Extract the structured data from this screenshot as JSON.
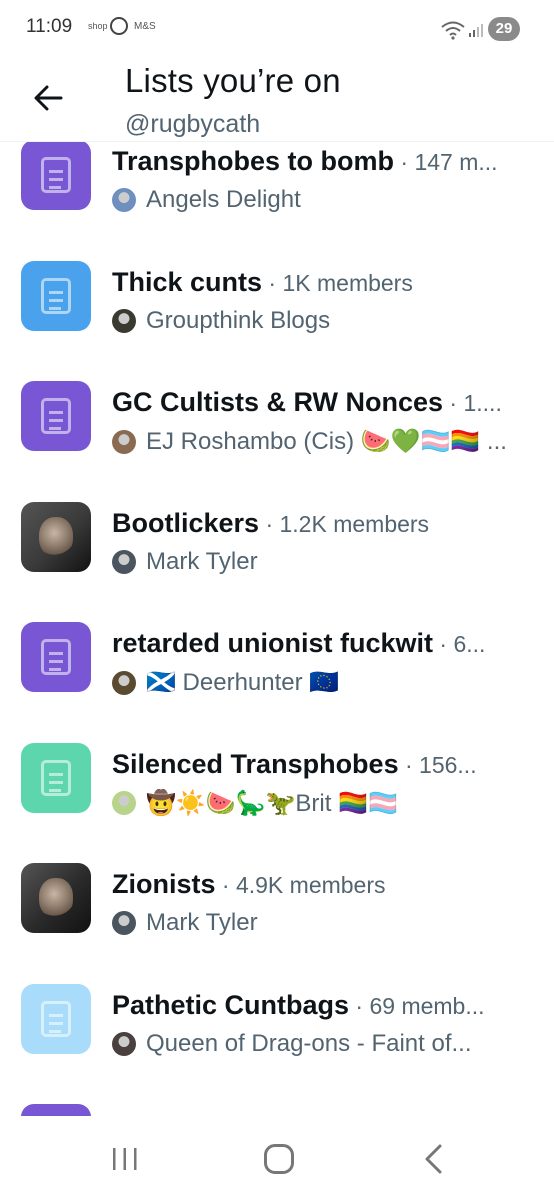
{
  "status_bar": {
    "time": "11:09",
    "notif_shop": "shop",
    "notif_ms": "M&S",
    "battery": "29"
  },
  "header": {
    "title": "Lists you’re on",
    "handle": "@rugbycath"
  },
  "lists": [
    {
      "name": "Transphobes to bomb",
      "meta": " · 147 m...",
      "owner": "Angels Delight",
      "icon_color": "#7856d4",
      "icon_type": "doc",
      "avatar_color": "#6f8fbf"
    },
    {
      "name": "Thick cunts",
      "meta": " · 1K members",
      "owner": "Groupthink Blogs",
      "icon_color": "#4ba2ec",
      "icon_type": "doc",
      "avatar_color": "#3a3a30"
    },
    {
      "name": "GC Cultists & RW Nonces",
      "meta": " · 1....",
      "owner": "EJ Roshambo (Cis) 🍉💚🏳️‍⚧️🏳️‍🌈 ...",
      "icon_color": "#7856d4",
      "icon_type": "doc",
      "avatar_color": "#8a6a50"
    },
    {
      "name": "Bootlickers",
      "meta": " · 1.2K members",
      "owner": "Mark Tyler",
      "icon_color": "#3a3a3a",
      "icon_type": "photo",
      "avatar_color": "#4a5560"
    },
    {
      "name": "retarded unionist fuckwit",
      "meta": " · 6...",
      "owner": "🏴󠁧󠁢󠁳󠁣󠁴󠁿 Deerhunter 🇪🇺",
      "icon_color": "#7856d4",
      "icon_type": "doc",
      "avatar_color": "#5a4a30"
    },
    {
      "name": "Silenced Transphobes",
      "meta": " · 156...",
      "owner": "🤠☀️🍉🦕🦖Brit 🏳️‍🌈🏳️‍⚧️",
      "icon_color": "#5dd6ae",
      "icon_type": "doc",
      "avatar_color": "#b7d48a"
    },
    {
      "name": "Zionists",
      "meta": " · 4.9K members",
      "owner": "Mark Tyler",
      "icon_color": "#2a2a2a",
      "icon_type": "photo",
      "avatar_color": "#4a5560"
    },
    {
      "name": "Pathetic Cuntbags",
      "meta": " · 69 memb...",
      "owner": "Queen of Drag-ons - Faint of...",
      "icon_color": "#a9dcfb",
      "icon_type": "doc",
      "avatar_color": "#4a4040"
    },
    {
      "name": "",
      "meta": "",
      "owner": "",
      "icon_color": "#7856d4",
      "icon_type": "doc",
      "avatar_color": "#7856d4"
    }
  ],
  "icons": {
    "back": "arrow-left-icon",
    "list": "list-document-icon",
    "nav_recent": "recent-apps-icon",
    "nav_home": "home-icon",
    "nav_back": "chevron-left-icon"
  },
  "colors": {
    "primary_text": "#0f1419",
    "secondary_text": "#536471"
  }
}
